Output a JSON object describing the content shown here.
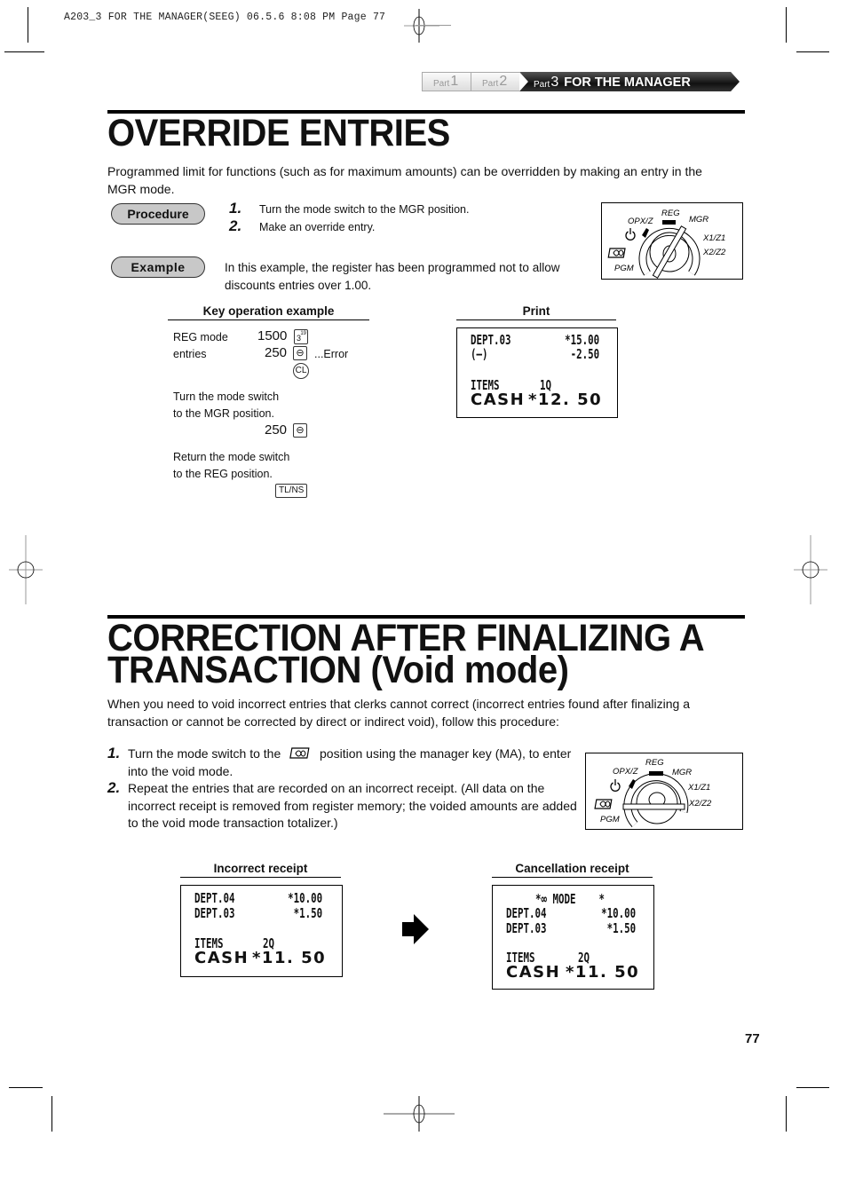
{
  "slug": {
    "text": "A203_3 FOR THE MANAGER(SEEG)  06.5.6 8:08 PM  Page 77"
  },
  "part_nav": {
    "items": [
      {
        "prefix": "Part",
        "num": "1",
        "title": "",
        "active": false
      },
      {
        "prefix": "Part",
        "num": "2",
        "title": "",
        "active": false
      },
      {
        "prefix": "Part",
        "num": "3",
        "title": "FOR THE MANAGER",
        "active": true
      }
    ]
  },
  "override": {
    "title": "OVERRIDE ENTRIES",
    "intro": "Programmed limit for functions (such as for maximum amounts) can be overridden by making an entry in the MGR mode.",
    "procedure_label": "Procedure",
    "steps": [
      {
        "num": "1.",
        "text": "Turn the mode switch to the MGR position."
      },
      {
        "num": "2.",
        "text": "Make an override entry."
      }
    ],
    "example_label": "Example",
    "example_text": "In this example, the register has been programmed not to allow discounts entries over 1.00.",
    "mode_switch": {
      "labels": [
        "REG",
        "OPX/Z",
        "MGR",
        "X1/Z1",
        "X2/Z2",
        "PGM"
      ],
      "position": "MGR"
    },
    "key_operation": {
      "heading": "Key operation example",
      "lines": [
        {
          "label": "REG mode",
          "value": "1500",
          "key": "3",
          "key_sup": "19",
          "note": ""
        },
        {
          "label": "entries",
          "value": "250",
          "key": "⊖",
          "note": "...Error"
        },
        {
          "round_key": "CL"
        },
        {
          "text1": "Turn the mode switch",
          "text2": "to the MGR position."
        },
        {
          "value": "250",
          "key": "⊖"
        },
        {
          "text1": "Return the mode switch",
          "text2": "to the REG position."
        },
        {
          "key": "TL/NS"
        }
      ]
    },
    "print": {
      "heading": "Print",
      "rows": [
        {
          "left": "DEPT.03",
          "right": "*15.00"
        },
        {
          "left": " (—)",
          "right": "-2.50"
        },
        {
          "left": "ITEMS",
          "mid": "1Q"
        },
        {
          "left": "CASH",
          "right": "*12. 50",
          "big": true
        }
      ]
    }
  },
  "correction": {
    "title_line1": "CORRECTION AFTER FINALIZING A",
    "title_line2": "TRANSACTION  (Void mode)",
    "intro": "When you need to void incorrect entries that clerks cannot correct (incorrect entries found after finalizing a transaction or cannot be corrected by direct or indirect void), follow this procedure:",
    "steps": [
      {
        "num": "1.",
        "text_before": "Turn the mode switch to the",
        "icon": "void-mode-icon",
        "text_after": "position using the manager key (MA), to enter into the void mode."
      },
      {
        "num": "2.",
        "text": "Repeat the entries that are recorded on an incorrect receipt.  (All data on the incorrect receipt is removed from register memory; the voided amounts are added to the void mode transaction totalizer.)"
      }
    ],
    "mode_switch": {
      "labels": [
        "REG",
        "OPX/Z",
        "MGR",
        "X1/Z1",
        "X2/Z2",
        "PGM"
      ],
      "position": "VOID"
    },
    "incorrect_receipt": {
      "heading": "Incorrect receipt",
      "rows": [
        {
          "left": "DEPT.04",
          "right": "*10.00"
        },
        {
          "left": "DEPT.03",
          "right": "*1.50"
        },
        {
          "left": "ITEMS",
          "mid": "2Q"
        },
        {
          "left": "CASH",
          "right": "*11. 50",
          "big": true
        }
      ]
    },
    "cancellation_receipt": {
      "heading": "Cancellation receipt",
      "header_line": "*∞ MODE    *",
      "rows": [
        {
          "left": "DEPT.04",
          "right": "*10.00"
        },
        {
          "left": "DEPT.03",
          "right": "*1.50"
        },
        {
          "left": "ITEMS",
          "mid": "2Q"
        },
        {
          "left": "CASH",
          "right": "*11. 50",
          "big": true
        }
      ]
    }
  },
  "page_number": "77"
}
